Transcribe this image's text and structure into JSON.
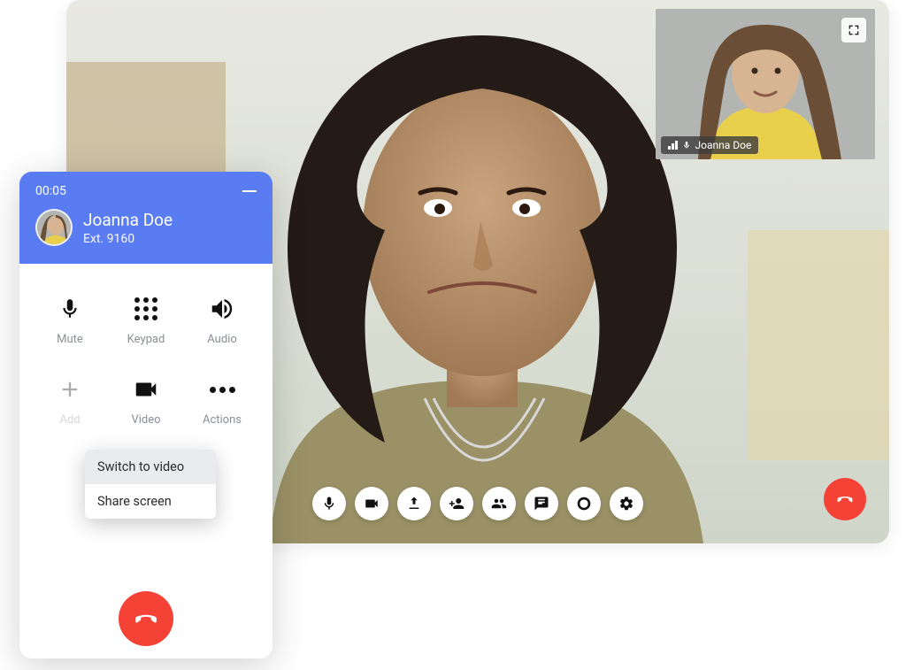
{
  "pip": {
    "participant_name": "Joanna Doe"
  },
  "toolbar": {
    "mic": "microphone-icon",
    "video": "video-icon",
    "share": "share-icon",
    "add_one": "add-participant-icon",
    "add_many": "participants-icon",
    "chat": "chat-icon",
    "record": "record-icon",
    "settings": "gear-icon"
  },
  "panel": {
    "timer": "00:05",
    "caller_name": "Joanna Doe",
    "caller_ext": "Ext. 9160",
    "buttons": {
      "mute": "Mute",
      "keypad": "Keypad",
      "audio": "Audio",
      "add": "Add",
      "video": "Video",
      "actions": "Actions"
    }
  },
  "popover": {
    "switch_video": "Switch to video",
    "share_screen": "Share screen"
  }
}
